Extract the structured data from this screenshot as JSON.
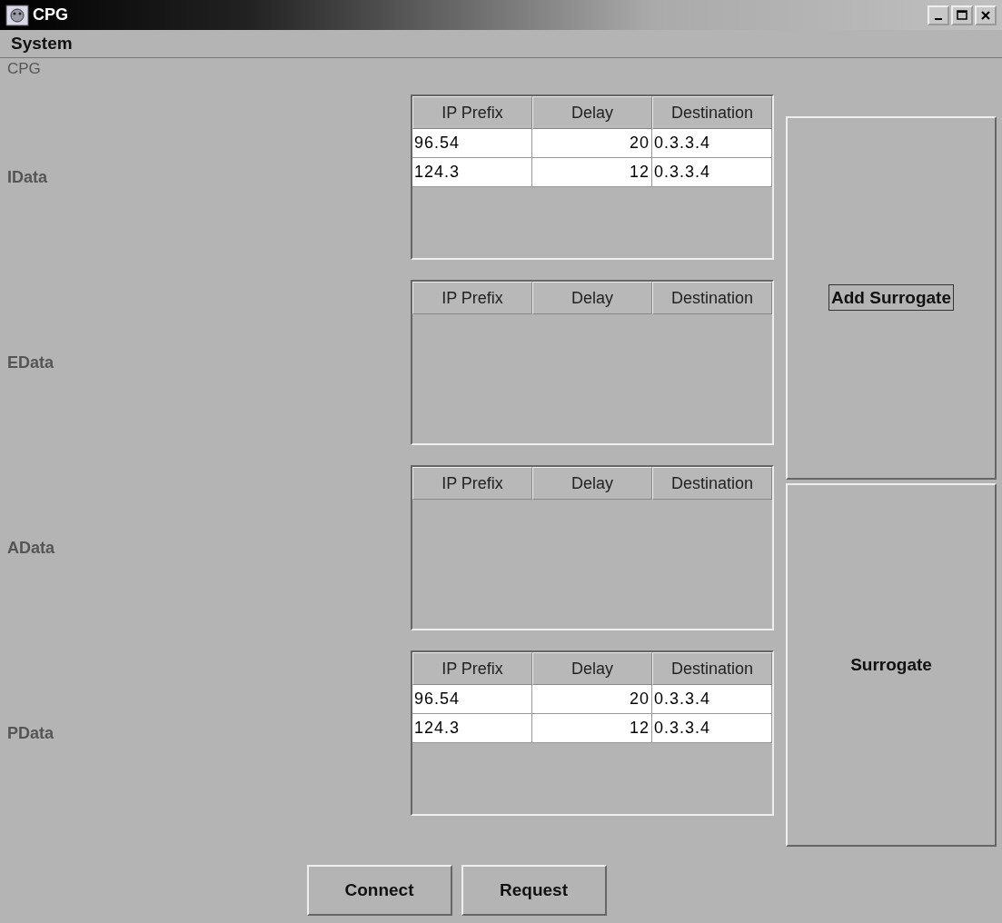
{
  "window": {
    "title": "CPG"
  },
  "menu": [
    "System"
  ],
  "panel_label": "CPG",
  "sections": [
    {
      "label": "IData",
      "columns": [
        "IP Prefix",
        "Delay",
        "Destination"
      ],
      "rows": [
        [
          "96.54",
          "20",
          "0.3.3.4"
        ],
        [
          "124.3",
          "12",
          "0.3.3.4"
        ]
      ]
    },
    {
      "label": "EData",
      "columns": [
        "IP Prefix",
        "Delay",
        "Destination"
      ]
    },
    {
      "label": "AData",
      "columns": [
        "IP Prefix",
        "Delay",
        "Destination"
      ]
    },
    {
      "label": "PData",
      "columns": [
        "IP Prefix",
        "Delay",
        "Destination"
      ],
      "rows": [
        [
          "96.54",
          "20",
          "0.3.3.4"
        ],
        [
          "124.3",
          "12",
          "0.3.3.4"
        ]
      ]
    }
  ],
  "side_buttons": [
    {
      "label": "Add Surrogate",
      "focused": true
    },
    {
      "label": "Surrogate",
      "focused": false
    }
  ],
  "buttons": [
    "Connect",
    "Request"
  ]
}
